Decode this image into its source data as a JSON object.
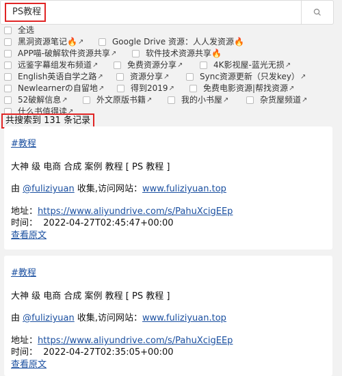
{
  "search": {
    "value": "PS教程"
  },
  "filters": {
    "select_all": "全选",
    "rows": [
      [
        "黑洞资源笔记🔥",
        "Google Drive 资源：人人发资源🔥"
      ],
      [
        "APP喵-破解软件资源共享",
        "软件技术资源共享🔥"
      ],
      [
        "远鉴字幕组发布频道",
        "免费资源分享",
        "4K影视屋-蓝光无损"
      ],
      [
        "English英语自学之路",
        "资源分享",
        "Sync资源更新（只发key）"
      ],
      [
        "Newlearnerの自留地",
        "得到2019",
        "免费电影资源|帮找资源"
      ],
      [
        "52破解信息",
        "外文原版书籍",
        "我的小书屋",
        "杂货屋频道"
      ],
      [
        "什么书值得读"
      ]
    ]
  },
  "result_count": "共搜索到 131 条记录",
  "results": [
    {
      "tag": "#教程",
      "title": "大神 级 电商 合成 案例 教程 [ PS 教程 ]",
      "by_prefix": "由 ",
      "author": "@fuliziyuan",
      "by_middle": " 收集,访问网站：",
      "site": "www.fuliziyuan.top",
      "addr_label": "地址：",
      "url": "https://www.aliyundrive.com/s/PahuXcigEEp",
      "time_label": "时间：",
      "time": "2022-04-27T02:45:47+00:00",
      "view_original": "查看原文"
    },
    {
      "tag": "#教程",
      "title": "大神 级 电商 合成 案例 教程 [ PS 教程 ]",
      "by_prefix": "由 ",
      "author": "@fuliziyuan",
      "by_middle": " 收集,访问网站：",
      "site": "www.fuliziyuan.top",
      "addr_label": "地址：",
      "url": "https://www.aliyundrive.com/s/PahuXcigEEp",
      "time_label": "时间：",
      "time": "2022-04-27T02:35:05+00:00",
      "view_original": "查看原文"
    }
  ]
}
